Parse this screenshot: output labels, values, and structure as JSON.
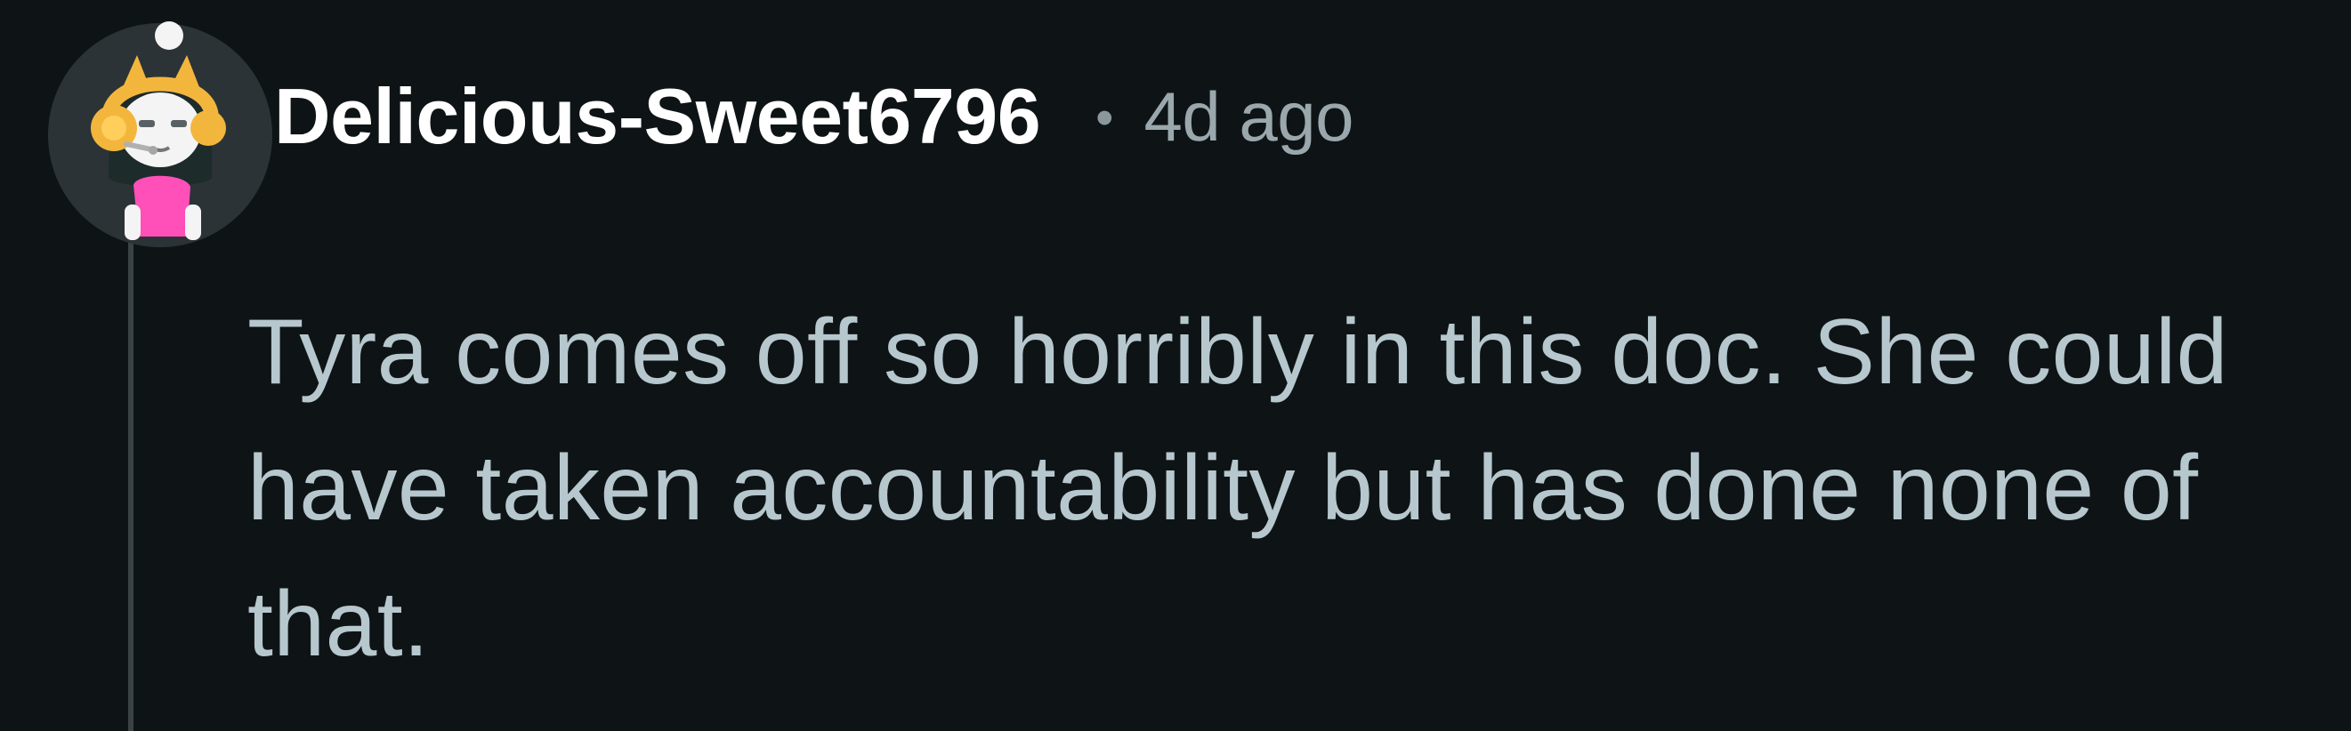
{
  "comment": {
    "author": "Delicious-Sweet6796",
    "separator": "•",
    "timestamp": "4d ago",
    "body": "Tyra comes off so horribly in this doc. She could have taken accountability but has done none of that.",
    "avatar": {
      "icon": "user-avatar-icon",
      "description_colors": {
        "background": "#2b3336",
        "skin": "#f2f2f2",
        "hair": "#1d2b2a",
        "headphones": "#f3b63d",
        "shirt": "#ff4fb8"
      }
    }
  },
  "theme": {
    "background": "#0e1416",
    "username_color": "#ffffff",
    "meta_color": "#9aa8ad",
    "body_color": "#b7c7ce",
    "thread_line_color": "#3a4246"
  }
}
